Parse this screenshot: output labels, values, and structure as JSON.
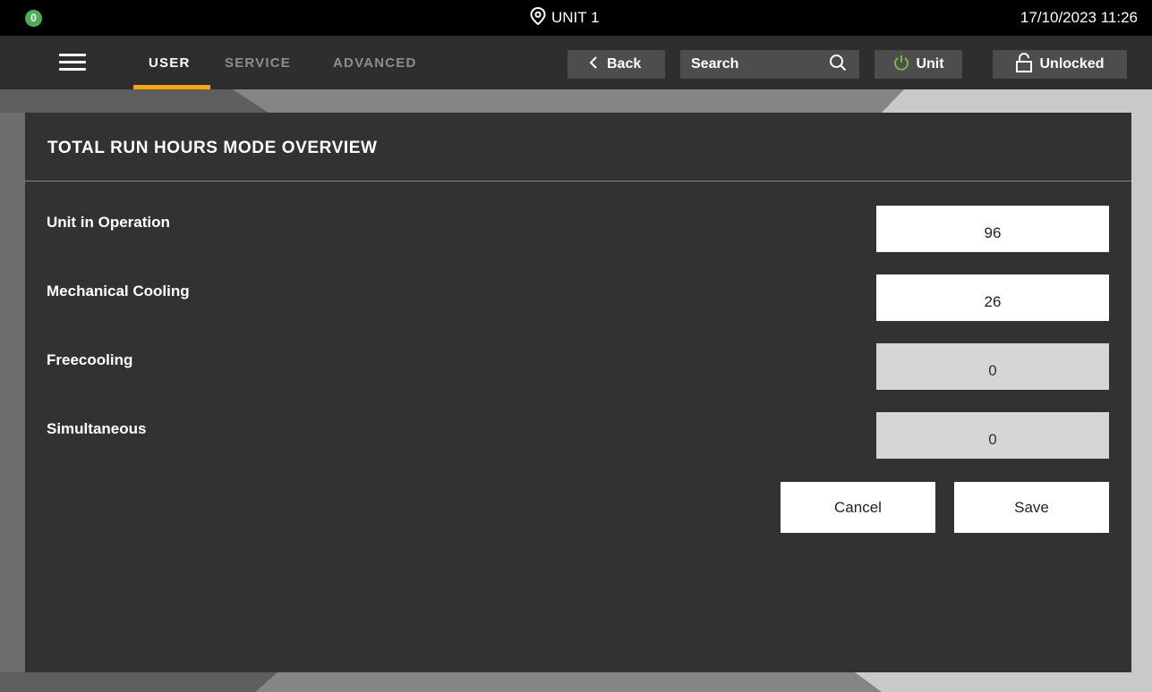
{
  "status_bar": {
    "badge_count": "0",
    "unit_name": "UNIT 1",
    "datetime": "17/10/2023 11:26"
  },
  "nav": {
    "tabs": [
      {
        "label": "USER",
        "active": true
      },
      {
        "label": "SERVICE",
        "active": false
      },
      {
        "label": "ADVANCED",
        "active": false
      }
    ],
    "back_label": "Back",
    "search_label": "Search",
    "unit_label": "Unit",
    "lock_label": "Unlocked"
  },
  "panel": {
    "title": "TOTAL RUN HOURS MODE OVERVIEW",
    "rows": [
      {
        "label": "Unit in Operation",
        "value": "96",
        "editable": true
      },
      {
        "label": "Mechanical Cooling",
        "value": "26",
        "editable": true
      },
      {
        "label": "Freecooling",
        "value": "0",
        "editable": false
      },
      {
        "label": "Simultaneous",
        "value": "0",
        "editable": false
      }
    ],
    "cancel_label": "Cancel",
    "save_label": "Save"
  },
  "colors": {
    "accent": "#f5a800",
    "status_ok": "#4caf50",
    "power_icon": "#6fbf3f",
    "panel_bg": "#323232"
  }
}
